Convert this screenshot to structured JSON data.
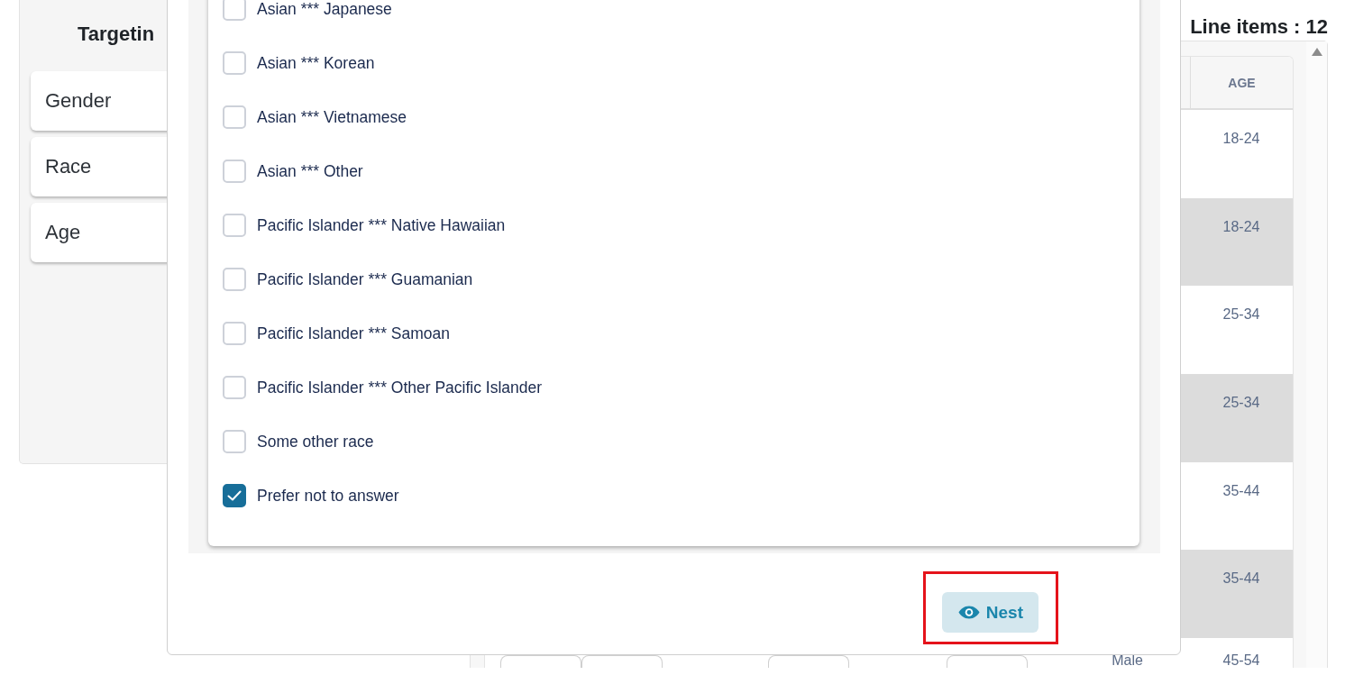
{
  "targeting_panel": {
    "title": "Targetin",
    "items": [
      {
        "label": "Gender"
      },
      {
        "label": "Race"
      },
      {
        "label": "Age"
      }
    ]
  },
  "line_items": {
    "label": "Line items : 12"
  },
  "table": {
    "columns": [
      {
        "label": "AGE"
      }
    ],
    "rows": [
      {
        "kind": "plain",
        "age": "18-24"
      },
      {
        "kind": "plain",
        "age": "18-24"
      },
      {
        "kind": "plain",
        "age": "25-34"
      },
      {
        "kind": "plain",
        "age": "25-34"
      },
      {
        "kind": "plain",
        "age": "35-44"
      },
      {
        "kind": "plain",
        "age": "35-44"
      },
      {
        "kind": "editable",
        "gender": "Male",
        "age": "45-54"
      }
    ]
  },
  "modal": {
    "options": [
      {
        "label": "Asian *** Japanese",
        "checked": false
      },
      {
        "label": "Asian *** Korean",
        "checked": false
      },
      {
        "label": "Asian *** Vietnamese",
        "checked": false
      },
      {
        "label": "Asian *** Other",
        "checked": false
      },
      {
        "label": "Pacific Islander *** Native Hawaiian",
        "checked": false
      },
      {
        "label": "Pacific Islander *** Guamanian",
        "checked": false
      },
      {
        "label": "Pacific Islander *** Samoan",
        "checked": false
      },
      {
        "label": "Pacific Islander *** Other Pacific Islander",
        "checked": false
      },
      {
        "label": "Some other race",
        "checked": false
      },
      {
        "label": "Prefer not to answer",
        "checked": true
      }
    ],
    "button": {
      "label": "Nest",
      "highlighted": true
    }
  }
}
